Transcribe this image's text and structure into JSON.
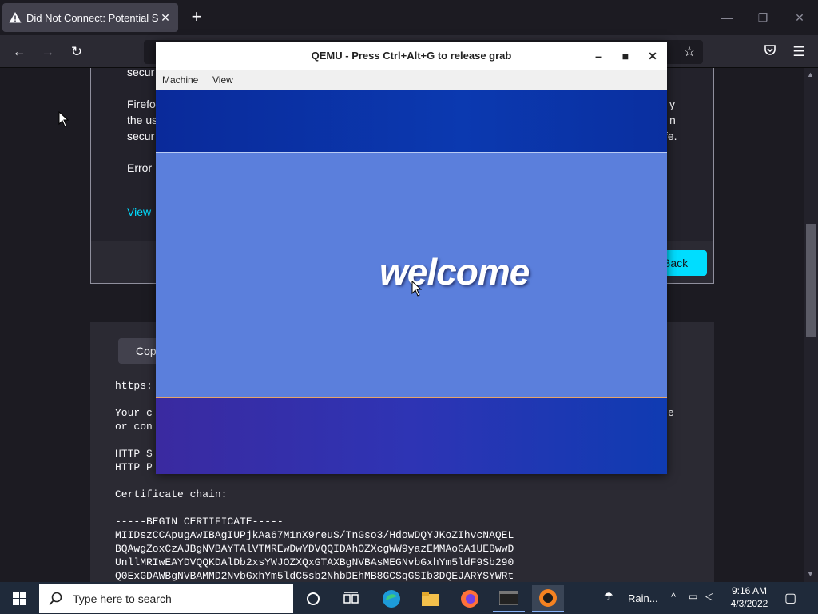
{
  "browser": {
    "tab_title": "Did Not Connect: Potential Sec",
    "new_tab_label": "+",
    "window_controls": [
      "minimize",
      "restore",
      "close"
    ]
  },
  "page": {
    "para1_line": "secur",
    "para2_lines": [
      "Firefo",
      "the us",
      "secur"
    ],
    "para2_right": [
      "y",
      "n",
      "fe."
    ],
    "error_label": "Error",
    "view_link": "View",
    "back_button": "Back",
    "copy_button": "Cop",
    "cert_lines": [
      "https:",
      "",
      "Your c",
      "or con",
      "",
      "HTTP S",
      "HTTP P",
      "",
      "Certificate chain:",
      "",
      "-----BEGIN CERTIFICATE-----",
      "MIIDszCCApugAwIBAgIUPjkAa67M1nX9reuS/TnGso3/HdowDQYJKoZIhvcNAQEL",
      "BQAwgZoxCzAJBgNVBAYTAlVTMREwDwYDVQQIDAhOZXcgWW9yazEMMAoGA1UEBwwD",
      "UnllMRIwEAYDVQQKDAlDb2xsYWJOZXQxGTAXBgNVBAsMEGNvbGxhYm5ldF9Sb290",
      "Q0ExGDAWBgNVBAMMD2NvbGxhYm5ldC5sb2NhbDEhMB8GCSqGSIb3DQEJARYSYWRt"
    ],
    "cert_right_fragments": [
      "e"
    ]
  },
  "qemu": {
    "title": "QEMU - Press Ctrl+Alt+G to release grab",
    "menu": [
      "Machine",
      "View"
    ],
    "screen_text": "welcome"
  },
  "taskbar": {
    "search_placeholder": "Type here to search",
    "weather": "Rain...",
    "time": "9:16 AM",
    "date": "4/3/2022"
  },
  "colors": {
    "firefox_bg": "#1c1b22",
    "accent": "#00ddff",
    "qemu_blue": "#5b7fdc",
    "taskbar": "#1f2a3a"
  }
}
